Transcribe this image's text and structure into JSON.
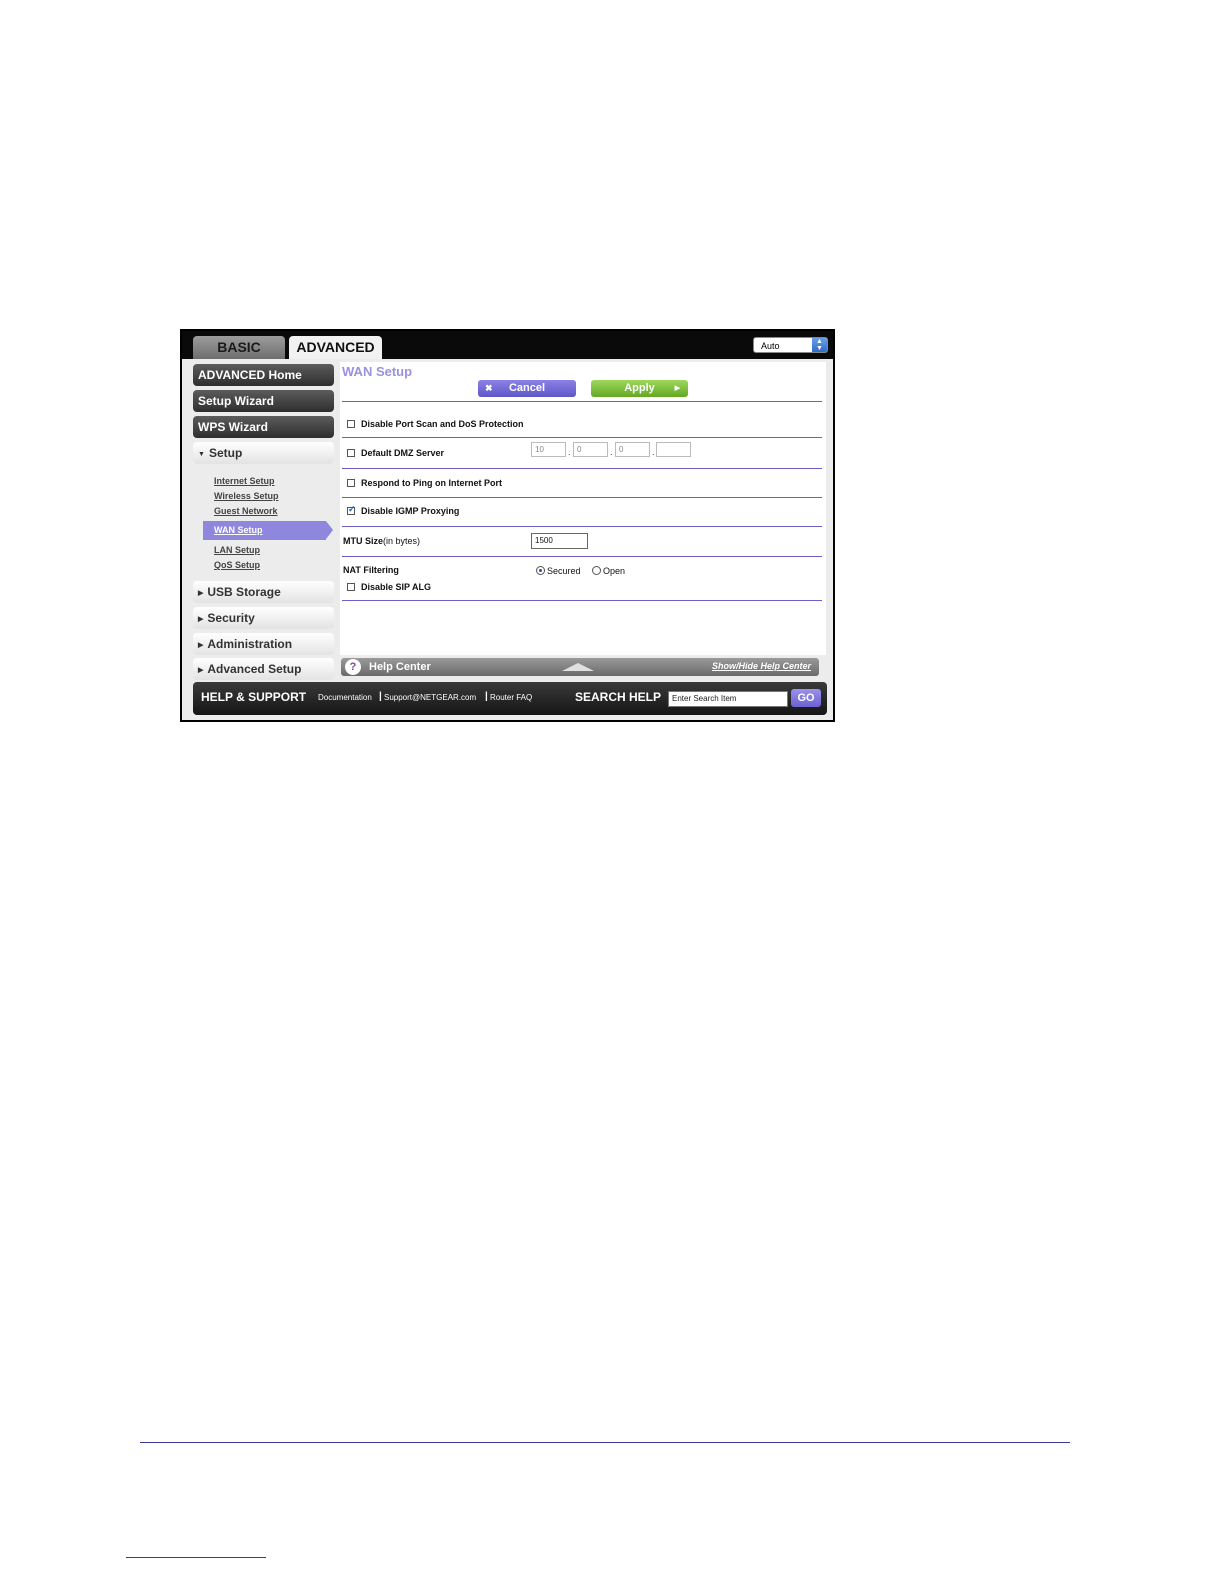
{
  "tabs": {
    "basic": "BASIC",
    "advanced": "ADVANCED"
  },
  "language_select": {
    "value": "Auto"
  },
  "sidebar": {
    "advanced_home": "ADVANCED Home",
    "setup_wizard": "Setup Wizard",
    "wps_wizard": "WPS Wizard",
    "setup": "Setup",
    "setup_links": [
      "Internet Setup",
      "Wireless Setup",
      "Guest Network",
      "WAN Setup",
      "LAN Setup",
      "QoS Setup"
    ],
    "usb_storage": "USB Storage",
    "security": "Security",
    "administration": "Administration",
    "advanced_setup": "Advanced Setup"
  },
  "main": {
    "title": "WAN Setup",
    "cancel": "Cancel",
    "apply": "Apply",
    "disable_port_scan": {
      "label": "Disable Port Scan and DoS Protection",
      "checked": false
    },
    "dmz": {
      "label": "Default DMZ Server",
      "checked": false,
      "ip": [
        "10",
        "0",
        "0",
        ""
      ]
    },
    "respond_ping": {
      "label": "Respond to Ping on Internet Port",
      "checked": false
    },
    "disable_igmp": {
      "label": "Disable IGMP Proxying",
      "checked": true
    },
    "mtu": {
      "label": "MTU Size",
      "unit": "(in bytes)",
      "value": "1500"
    },
    "nat": {
      "label": "NAT Filtering",
      "secured": "Secured",
      "open": "Open",
      "selected": "Secured"
    },
    "sip_alg": {
      "label": "Disable SIP ALG",
      "checked": false
    }
  },
  "help_center": {
    "title": "Help Center",
    "toggle": "Show/Hide Help Center"
  },
  "footer": {
    "title": "HELP & SUPPORT",
    "links": [
      "Documentation",
      "Support@NETGEAR.com",
      "Router FAQ"
    ],
    "search_label": "SEARCH HELP",
    "search_value": "Enter Search Item",
    "go": "GO"
  }
}
